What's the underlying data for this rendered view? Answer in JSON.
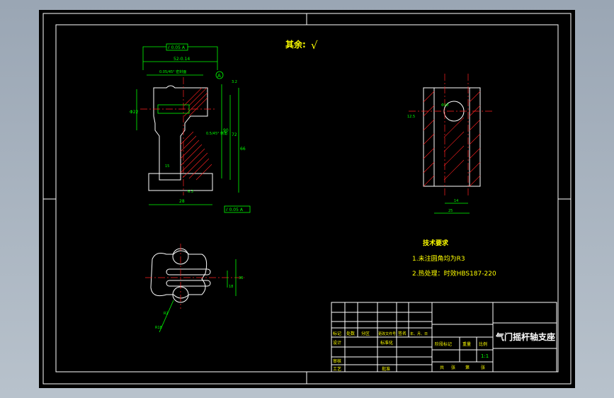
{
  "drawing": {
    "surface_roughness_note": "其余:",
    "roughness_symbol": "√",
    "technical_requirements": {
      "heading": "技术要求",
      "items": [
        "1.未注圆角均为R3",
        "2.热处理：时效HBS187-220"
      ]
    },
    "front_view_dims": {
      "top_tolerance_frame": "⫽ 0.05 A",
      "width_top": "52-0.14",
      "bore_spec": "0.05/45° 密封面",
      "height_left": "Φ22",
      "small_r": "5.2",
      "cb_note": "0.5/45° 倒角",
      "ra_right": "3.2",
      "h_90": "90",
      "h_72": "72",
      "h_66": "66",
      "bottom_width": "28",
      "w_15": "15",
      "base_ra": "6.3",
      "datum": "A",
      "bottom_tolerance_frame": "⫽ 0.05 A"
    },
    "side_view_dims": {
      "ra": "12.5",
      "hole": "Φ18",
      "w_14": "14",
      "w_25": "25"
    },
    "top_view_dims": {
      "r_18": "R18",
      "r_2": "R2",
      "w_36": "36",
      "w_18": "18"
    },
    "title_block": {
      "part_name": "气门摇杆轴支座",
      "scale": "1:1",
      "labels": {
        "mark": "标记",
        "count": "处数",
        "zone": "分区",
        "doc_no": "更改文件号",
        "sign": "签名",
        "date": "年、月、日",
        "design": "设计",
        "standard": "标准化",
        "review": "审核",
        "process": "工艺",
        "approve": "批准",
        "stage_mark": "阶段标记",
        "weight": "重量",
        "ratio": "比例",
        "sheets_total": "共",
        "sheet_label": "张",
        "sheet_no": "第",
        "sheet_label2": "张"
      }
    }
  }
}
